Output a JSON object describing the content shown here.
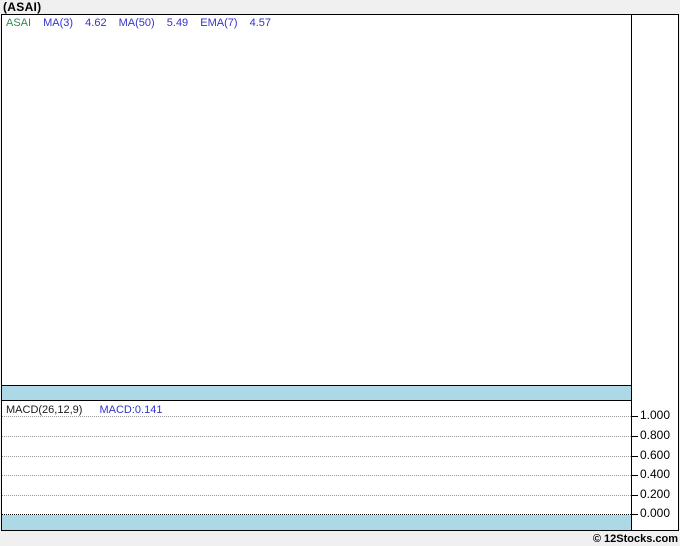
{
  "page": {
    "title": "(ASAI)",
    "footer_credit": "© 12Stocks.com"
  },
  "colors": {
    "page_background": "#f0f0f0",
    "panel_background": "#ffffff",
    "border": "#000000",
    "date_band": "#add8e6",
    "gridline": "#999999",
    "zero_line": "#000000",
    "symbol_green": "#2e8b57",
    "indicator_blue": "#3333cc"
  },
  "main_chart": {
    "legend": {
      "symbol": "ASAI",
      "items": [
        {
          "label": "MA(3)",
          "value": "4.62"
        },
        {
          "label": "MA(50)",
          "value": "5.49"
        },
        {
          "label": "EMA(7)",
          "value": "4.57"
        }
      ]
    }
  },
  "macd_panel": {
    "label": "MACD(26,12,9)",
    "value_label": "MACD:0.141",
    "y_axis": {
      "ticks": [
        "1.000",
        "0.800",
        "0.600",
        "0.400",
        "0.200",
        "0.000"
      ]
    }
  },
  "chart_data": [
    {
      "type": "line",
      "title": "ASAI price panel",
      "legend": [
        "ASAI",
        "MA(3) 4.62",
        "MA(50) 5.49",
        "EMA(7) 4.57"
      ],
      "series": [],
      "grid": false,
      "note": "plot area rendered empty - no price data points visible"
    },
    {
      "type": "line",
      "title": "MACD(26,12,9)",
      "annotations": [
        "MACD:0.141"
      ],
      "series": [],
      "yticks": [
        1.0,
        0.8,
        0.6,
        0.4,
        0.2,
        0.0
      ],
      "ylim": [
        -0.1,
        1.1
      ],
      "grid": true,
      "legend_position": "top-left",
      "note": "gridlines only - no MACD line/histogram points visible"
    }
  ]
}
